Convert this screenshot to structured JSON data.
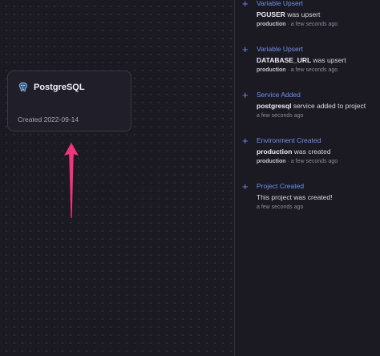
{
  "canvas": {
    "service": {
      "name": "PostgreSQL",
      "created": "Created 2022-09-14",
      "icon": "postgresql-elephant-icon"
    }
  },
  "feed": {
    "events": [
      {
        "title": "Variable Upsert",
        "subject": "PGUSER",
        "message": " was upsert",
        "environment": "production",
        "time": " · a few seconds ago"
      },
      {
        "title": "Variable Upsert",
        "subject": "DATABASE_URL",
        "message": " was upsert",
        "environment": "production",
        "time": " · a few seconds ago"
      },
      {
        "title": "Service Added",
        "subject": "postgresql",
        "message": " service added to project",
        "environment": "",
        "time": "a few seconds ago"
      },
      {
        "title": "Environment Created",
        "subject": "production",
        "message": " was created",
        "environment": "production",
        "time": " · a few seconds ago"
      },
      {
        "title": "Project Created",
        "subject": "",
        "message": "This project was created!",
        "environment": "",
        "time": "a few seconds ago"
      }
    ]
  },
  "colors": {
    "accent": "#6d94ea",
    "annotation_arrow": "#f0357a",
    "background": "#1b1922"
  }
}
